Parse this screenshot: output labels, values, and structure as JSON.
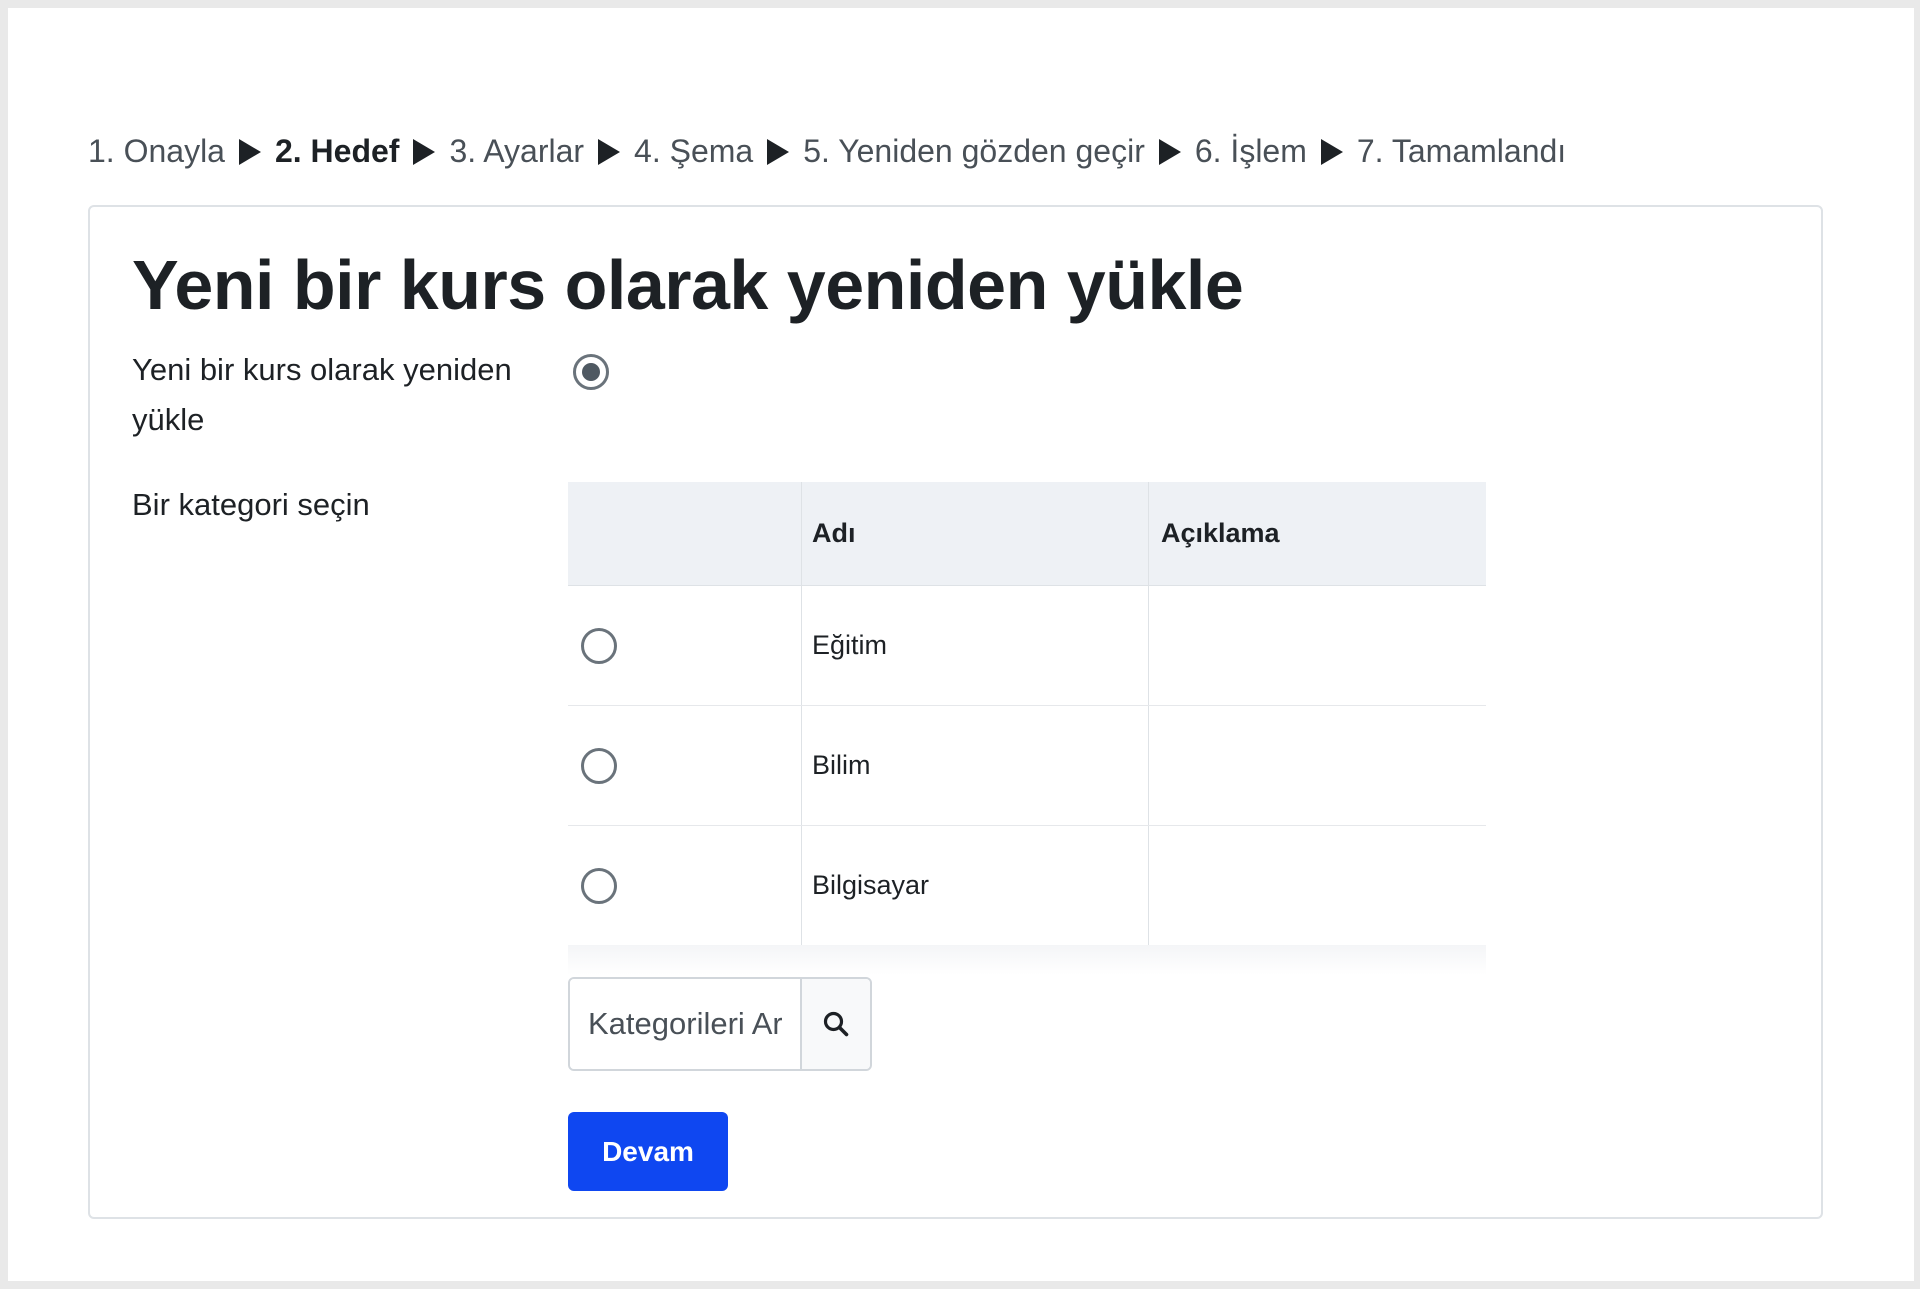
{
  "steps": [
    {
      "label": "1. Onayla",
      "current": false
    },
    {
      "label": "2. Hedef",
      "current": true
    },
    {
      "label": "3. Ayarlar",
      "current": false
    },
    {
      "label": "4. Şema",
      "current": false
    },
    {
      "label": "5. Yeniden gözden geçir",
      "current": false
    },
    {
      "label": "6. İşlem",
      "current": false
    },
    {
      "label": "7. Tamamlandı",
      "current": false
    }
  ],
  "card": {
    "title": "Yeni bir kurs olarak yeniden yükle",
    "restore_option_label": "Yeni bir kurs olarak yeniden yükle",
    "restore_option_selected": true,
    "category_label": "Bir kategori seçin",
    "table": {
      "headers": [
        "",
        "Adı",
        "Açıklama"
      ],
      "rows": [
        {
          "name": "Eğitim",
          "description": "",
          "selected": false
        },
        {
          "name": "Bilim",
          "description": "",
          "selected": false
        },
        {
          "name": "Bilgisayar",
          "description": "",
          "selected": false
        }
      ]
    },
    "search": {
      "placeholder": "Kategorileri Ara",
      "value": ""
    },
    "continue_label": "Devam"
  },
  "colors": {
    "primary": "#0f47f1",
    "table_header_bg": "#eef1f5",
    "text": "#1d2125"
  },
  "icons": [
    "triangle-right-icon",
    "search-icon"
  ]
}
